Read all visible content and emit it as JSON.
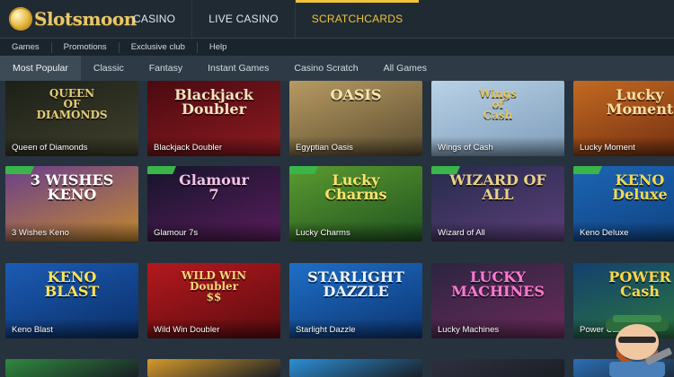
{
  "logo": {
    "text": "Slotsmoon"
  },
  "main_nav": [
    "CASINO",
    "LIVE CASINO",
    "SCRATCHCARDS"
  ],
  "main_nav_active": "SCRATCHCARDS",
  "sub_nav": [
    "Games",
    "Promotions",
    "Exclusive club",
    "Help"
  ],
  "tabs": [
    "Most Popular",
    "Classic",
    "Fantasy",
    "Instant Games",
    "Casino Scratch",
    "All Games"
  ],
  "active_tab": "Most Popular",
  "games": [
    {
      "title": "Queen of Diamonds",
      "art": [
        "QUEEN",
        "OF",
        "DIAMONDS"
      ],
      "bg": [
        "#1b2018",
        "#41402c"
      ],
      "fg": "#e6cc7a",
      "badge": false
    },
    {
      "title": "Blackjack Doubler",
      "art": [
        "Blackjack",
        "Doubler"
      ],
      "bg": [
        "#4a0a10",
        "#8d1b21"
      ],
      "fg": "#f4e3c0",
      "badge": false
    },
    {
      "title": "Egyptian Oasis",
      "art": [
        "OASIS"
      ],
      "bg": [
        "#b79a62",
        "#5a4c2f"
      ],
      "fg": "#f6e6b0",
      "badge": false
    },
    {
      "title": "Wings of Cash",
      "art": [
        "Wings",
        "of",
        "Cash"
      ],
      "bg": [
        "#b8d2e6",
        "#7e9cba"
      ],
      "fg": "#e5c45d",
      "badge": false
    },
    {
      "title": "Lucky Moment",
      "art": [
        "Lucky",
        "Moment"
      ],
      "bg": [
        "#c36a22",
        "#6d2a0f"
      ],
      "fg": "#fbe0a2",
      "badge": false
    },
    {
      "title": "3 Wishes Keno",
      "art": [
        "3 WISHES",
        "KENO"
      ],
      "bg": [
        "#6a3f8c",
        "#c4892e"
      ],
      "fg": "#ffffff",
      "badge": true
    },
    {
      "title": "Glamour 7s",
      "art": [
        "Glamour",
        "7"
      ],
      "bg": [
        "#14142a",
        "#5a1d5c"
      ],
      "fg": "#f3c3e4",
      "badge": true
    },
    {
      "title": "Lucky Charms",
      "art": [
        "Lucky",
        "Charms"
      ],
      "bg": [
        "#5b9a2f",
        "#1f5320"
      ],
      "fg": "#fbe26a",
      "badge": true
    },
    {
      "title": "Wizard of All",
      "art": [
        "WIZARD OF ALL"
      ],
      "bg": [
        "#262b4c",
        "#5c3f7a"
      ],
      "fg": "#e9d28a",
      "badge": true
    },
    {
      "title": "Keno Deluxe",
      "art": [
        "KENO",
        "Deluxe"
      ],
      "bg": [
        "#1c65b4",
        "#0f3f7d"
      ],
      "fg": "#f4d94d",
      "badge": true
    },
    {
      "title": "Keno Blast",
      "art": [
        "KENO",
        "BLAST"
      ],
      "bg": [
        "#1b5cb5",
        "#0b2e66"
      ],
      "fg": "#ffe35a",
      "badge": false
    },
    {
      "title": "Wild Win Doubler",
      "art": [
        "WILD WIN",
        "Doubler",
        "$$"
      ],
      "bg": [
        "#b3191d",
        "#5b0b10"
      ],
      "fg": "#f6d77b",
      "badge": false
    },
    {
      "title": "Starlight Dazzle",
      "art": [
        "STARLIGHT",
        "DAZZLE"
      ],
      "bg": [
        "#1f6fc7",
        "#0c3471"
      ],
      "fg": "#eaf4ff",
      "badge": false
    },
    {
      "title": "Lucky Machines",
      "art": [
        "LUCKY",
        "MACHINES"
      ],
      "bg": [
        "#2c2440",
        "#6b2b5a"
      ],
      "fg": "#ff7ad1",
      "badge": false
    },
    {
      "title": "Power Cash",
      "art": [
        "POWER",
        "Cash"
      ],
      "bg": [
        "#14406e",
        "#2c7a3b"
      ],
      "fg": "#ffd74a",
      "badge": false
    }
  ],
  "partial_row_colors": [
    "#2f8a3f",
    "#d69a2b",
    "#2c8fd6",
    "#2f3040",
    "#2a6fb6"
  ]
}
